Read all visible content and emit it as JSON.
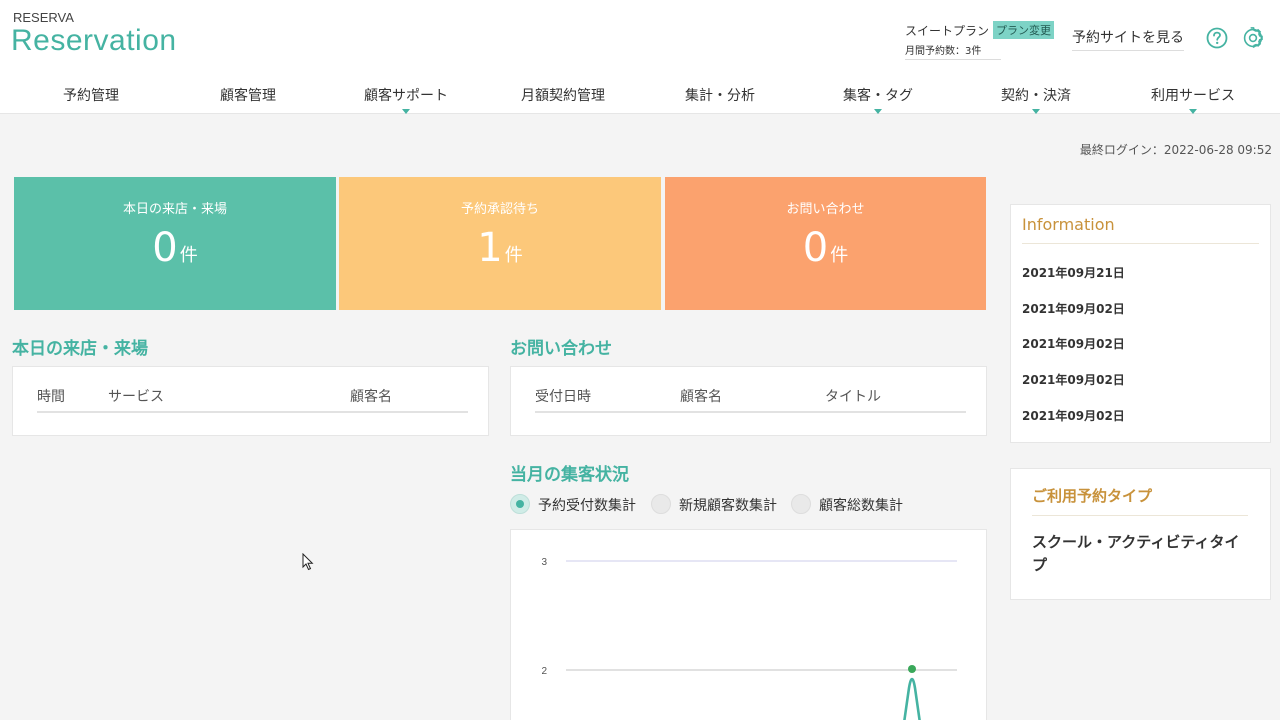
{
  "header": {
    "logo_small": "RESERVA",
    "logo_big": "Reservation",
    "plan_name": "スイートプラン",
    "plan_change_label": "プラン変更",
    "plan_count": "月間予約数：3件",
    "site_link": "予約サイトを見る",
    "help_icon": "question-circle-icon",
    "settings_icon": "gear-icon"
  },
  "nav": {
    "items": [
      {
        "label": "予約管理",
        "dropdown": false
      },
      {
        "label": "顧客管理",
        "dropdown": false
      },
      {
        "label": "顧客サポート",
        "dropdown": true
      },
      {
        "label": "月額契約管理",
        "dropdown": false
      },
      {
        "label": "集計・分析",
        "dropdown": false
      },
      {
        "label": "集客・タグ",
        "dropdown": true
      },
      {
        "label": "契約・決済",
        "dropdown": true
      },
      {
        "label": "利用サービス",
        "dropdown": true
      }
    ]
  },
  "last_login": "最終ログイン：2022-06-28 09:52",
  "stats": {
    "visits": {
      "label": "本日の来店・来場",
      "value": "0",
      "unit": "件"
    },
    "pending": {
      "label": "予約承認待ち",
      "value": "1",
      "unit": "件"
    },
    "inquiries": {
      "label": "お問い合わせ",
      "value": "0",
      "unit": "件"
    }
  },
  "visits_section": {
    "title": "本日の来店・来場",
    "columns": [
      "時間",
      "サービス",
      "顧客名"
    ]
  },
  "inquiry_section": {
    "title": "お問い合わせ",
    "columns": [
      "受付日時",
      "顧客名",
      "タイトル"
    ]
  },
  "monthly_section": {
    "title": "当月の集客状況",
    "options": [
      {
        "label": "予約受付数集計",
        "selected": true
      },
      {
        "label": "新規顧客数集計",
        "selected": false
      },
      {
        "label": "顧客総数集計",
        "selected": false
      }
    ]
  },
  "chart_data": {
    "type": "line",
    "y_ticks": [
      "3",
      "2"
    ],
    "ylim": [
      2,
      3
    ],
    "series": [
      {
        "values": [
          2
        ]
      }
    ],
    "colors": {
      "grid": "#d6d6ef",
      "line": "#45b3a2",
      "point": "#3aa85a"
    }
  },
  "information": {
    "title": "Information",
    "items": [
      "2021年09月21日",
      "2021年09月02日",
      "2021年09月02日",
      "2021年09月02日",
      "2021年09月02日"
    ]
  },
  "reservation_type": {
    "title": "ご利用予約タイプ",
    "value": "スクール・アクティビティタイプ"
  },
  "colors": {
    "brand": "#45b3a2",
    "card_green": "#5bc0a9",
    "card_yellow": "#fcc87a",
    "card_orange": "#fba26e",
    "info_title": "#c8923b"
  }
}
